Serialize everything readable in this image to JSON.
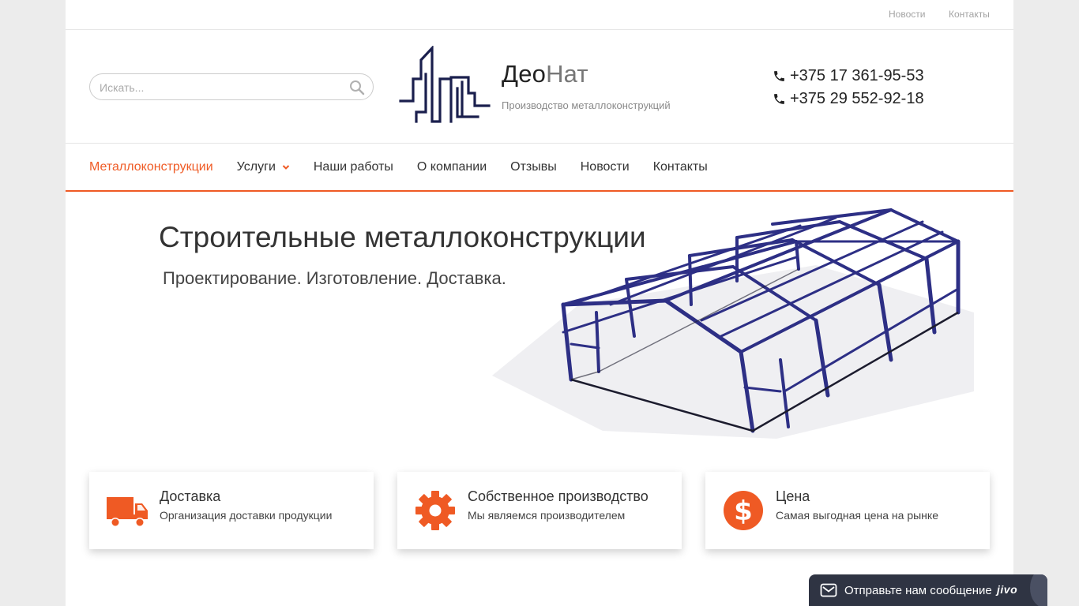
{
  "topbar": {
    "news": "Новости",
    "contacts": "Контакты"
  },
  "search": {
    "placeholder": "Искать..."
  },
  "brand": {
    "name_part1": "Део",
    "name_part2": "Нат",
    "tagline": "Производство металлоконструкций"
  },
  "phones": [
    "+375 17 361-95-53",
    "+375 29 552-92-18"
  ],
  "nav": {
    "items": [
      {
        "label": "Металлоконструкции",
        "active": true
      },
      {
        "label": "Услуги",
        "has_dropdown": true
      },
      {
        "label": "Наши работы"
      },
      {
        "label": "О компании"
      },
      {
        "label": "Отзывы"
      },
      {
        "label": "Новости"
      },
      {
        "label": "Контакты"
      }
    ]
  },
  "hero": {
    "title": "Строительные металлоконструкции",
    "subtitle": "Проектирование. Изготовление. Доставка."
  },
  "features": [
    {
      "icon": "truck-icon",
      "title": "Доставка",
      "desc": "Организация доставки продукции"
    },
    {
      "icon": "gear-icon",
      "title": "Собственное производство",
      "desc": "Мы являемся производителем"
    },
    {
      "icon": "dollar-icon",
      "title": "Цена",
      "desc": "Самая выгодная цена на рынке"
    }
  ],
  "chat": {
    "label": "Отправьте нам сообщение",
    "brand": "jivo"
  },
  "colors": {
    "accent": "#ef5a24",
    "logo": "#1a1f4d",
    "frame": "#2d2f85",
    "chat_bg": "#2f3443"
  }
}
